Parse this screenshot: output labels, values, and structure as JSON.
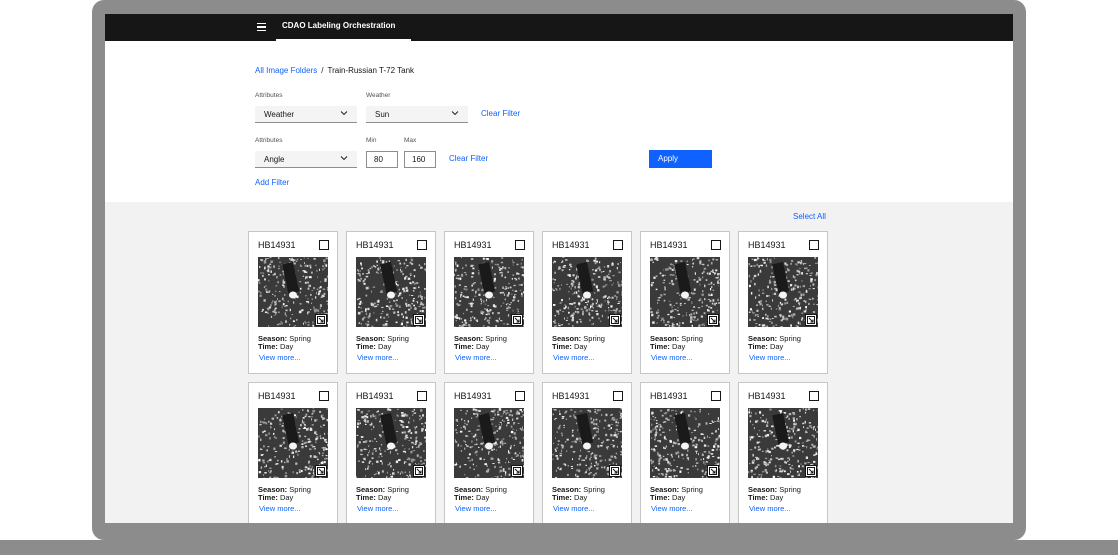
{
  "app": {
    "title": "CDAO Labeling Orchestration"
  },
  "breadcrumb": {
    "root": "All Image Folders",
    "separator": "/",
    "current": "Train-Russian T-72 Tank"
  },
  "filters": [
    {
      "attribute_label": "Attributes",
      "attribute_value": "Weather",
      "value_label": "Weather",
      "value": "Sun",
      "clear_label": "Clear Filter"
    },
    {
      "attribute_label": "Attributes",
      "attribute_value": "Angle",
      "min_label": "Min",
      "min_value": "80",
      "max_label": "Max",
      "max_value": "160",
      "clear_label": "Clear Filter"
    }
  ],
  "actions": {
    "apply_label": "Apply",
    "add_filter_label": "Add Filter",
    "select_all_label": "Select All"
  },
  "cards": [
    {
      "id": "HB14931",
      "season_label": "Season:",
      "season": "Spring",
      "time_label": "Time:",
      "time": "Day",
      "view_more": "View more..."
    },
    {
      "id": "HB14931",
      "season_label": "Season:",
      "season": "Spring",
      "time_label": "Time:",
      "time": "Day",
      "view_more": "View more..."
    },
    {
      "id": "HB14931",
      "season_label": "Season:",
      "season": "Spring",
      "time_label": "Time:",
      "time": "Day",
      "view_more": "View more..."
    },
    {
      "id": "HB14931",
      "season_label": "Season:",
      "season": "Spring",
      "time_label": "Time:",
      "time": "Day",
      "view_more": "View more..."
    },
    {
      "id": "HB14931",
      "season_label": "Season:",
      "season": "Spring",
      "time_label": "Time:",
      "time": "Day",
      "view_more": "View more..."
    },
    {
      "id": "HB14931",
      "season_label": "Season:",
      "season": "Spring",
      "time_label": "Time:",
      "time": "Day",
      "view_more": "View more..."
    },
    {
      "id": "HB14931",
      "season_label": "Season:",
      "season": "Spring",
      "time_label": "Time:",
      "time": "Day",
      "view_more": "View more..."
    },
    {
      "id": "HB14931",
      "season_label": "Season:",
      "season": "Spring",
      "time_label": "Time:",
      "time": "Day",
      "view_more": "View more..."
    },
    {
      "id": "HB14931",
      "season_label": "Season:",
      "season": "Spring",
      "time_label": "Time:",
      "time": "Day",
      "view_more": "View more..."
    },
    {
      "id": "HB14931",
      "season_label": "Season:",
      "season": "Spring",
      "time_label": "Time:",
      "time": "Day",
      "view_more": "View more..."
    },
    {
      "id": "HB14931",
      "season_label": "Season:",
      "season": "Spring",
      "time_label": "Time:",
      "time": "Day",
      "view_more": "View more..."
    },
    {
      "id": "HB14931",
      "season_label": "Season:",
      "season": "Spring",
      "time_label": "Time:",
      "time": "Day",
      "view_more": "View more..."
    }
  ],
  "colors": {
    "topbar": "#161616",
    "accent": "#0f62fe",
    "gallery_bg": "#f2f2f2",
    "frame": "#8c8c8c"
  },
  "icons": {
    "menu": "hamburger-menu-icon",
    "dropdown": "chevron-down-icon",
    "expand": "expand-icon",
    "checkbox": "checkbox-icon"
  }
}
